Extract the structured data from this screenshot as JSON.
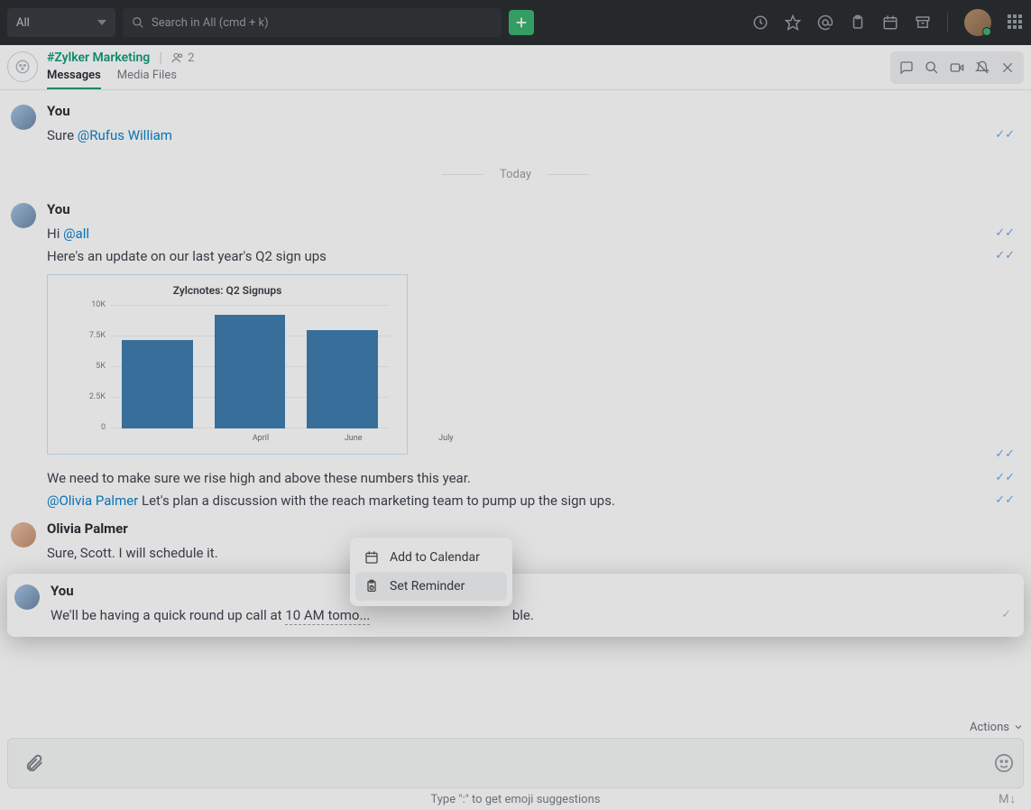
{
  "top": {
    "scope": "All",
    "search_placeholder": "Search in All (cmd + k)"
  },
  "channel": {
    "name": "#Zylker Marketing",
    "member_count": "2",
    "tabs": {
      "messages": "Messages",
      "media": "Media Files"
    }
  },
  "divider": "Today",
  "msgs": {
    "m1": {
      "sender": "You",
      "prefix": "Sure ",
      "mention": "@Rufus William"
    },
    "m2": {
      "sender": "You",
      "l1_prefix": "Hi ",
      "l1_mention": "@all",
      "l2": "Here's an update on our last year's Q2 sign ups",
      "l3": "We need to make sure we rise high and above these numbers this year.",
      "l4_mention": "@Olivia Palmer",
      "l4_rest": " Let's plan a discussion with the reach marketing team to pump up the sign ups."
    },
    "m3": {
      "sender": "Olivia Palmer",
      "l1": "Sure, Scott. I will schedule it."
    },
    "m4": {
      "sender": "You",
      "prefix": "We'll be having a quick round up call at  ",
      "time": "10 AM tomo...",
      "suffix_tail": "ble."
    }
  },
  "popup": {
    "add_calendar": "Add to Calendar",
    "set_reminder": "Set Reminder"
  },
  "footer": {
    "actions": "Actions",
    "hint": "Type \":\" to get emoji suggestions",
    "md": "M↓"
  },
  "chart_data": {
    "type": "bar",
    "title": "Zylcnotes: Q2 Signups",
    "categories": [
      "April",
      "June",
      "July"
    ],
    "values": [
      7200,
      9200,
      8000
    ],
    "ylim": [
      0,
      10000
    ],
    "yticks": [
      0,
      2500,
      5000,
      7500,
      10000
    ],
    "ytick_labels": [
      "0",
      "2.5K",
      "5K",
      "7.5K",
      "10K"
    ],
    "color": "#3f7fb0"
  }
}
